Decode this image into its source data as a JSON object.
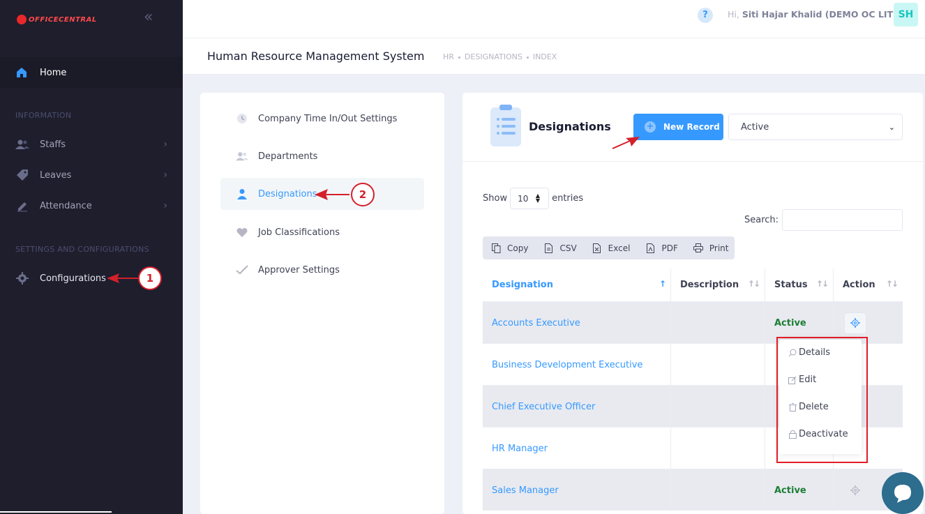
{
  "brand": {
    "logo_text": "OFFICECENTRAL"
  },
  "sidebar": {
    "home": "Home",
    "section_information": "INFORMATION",
    "items": [
      {
        "label": "Staffs"
      },
      {
        "label": "Leaves"
      },
      {
        "label": "Attendance"
      }
    ],
    "section_settings": "SETTINGS AND CONFIGURATIONS",
    "configurations": "Configurations"
  },
  "topbar": {
    "help": "?",
    "greeting_prefix": "Hi,",
    "user_name": "Siti Hajar Khalid (DEMO OC LITE)",
    "avatar_initials": "SH"
  },
  "subheader": {
    "title": "Human Resource Management System",
    "breadcrumbs": [
      "HR",
      "DESIGNATIONS",
      "INDEX"
    ]
  },
  "settings_menu": [
    {
      "label": "Company Time In/Out Settings",
      "icon": "clock-icon"
    },
    {
      "label": "Departments",
      "icon": "users-icon"
    },
    {
      "label": "Designations",
      "icon": "user-icon",
      "active": true
    },
    {
      "label": "Job Classifications",
      "icon": "heart-icon"
    },
    {
      "label": "Approver Settings",
      "icon": "check-icon"
    }
  ],
  "panel": {
    "title": "Designations",
    "new_record": "New Record",
    "status_filter": "Active",
    "show_label": "Show",
    "entries_value": "10",
    "entries_label": "entries",
    "search_label": "Search:",
    "export_buttons": [
      "Copy",
      "CSV",
      "Excel",
      "PDF",
      "Print"
    ]
  },
  "table": {
    "columns": [
      "Designation",
      "Description",
      "Status",
      "Action"
    ],
    "rows": [
      {
        "designation": "Accounts Executive",
        "description": "",
        "status": "Active"
      },
      {
        "designation": "Business Development Executive",
        "description": "",
        "status": ""
      },
      {
        "designation": "Chief Executive Officer",
        "description": "",
        "status": ""
      },
      {
        "designation": "HR Manager",
        "description": "",
        "status": ""
      },
      {
        "designation": "Sales Manager",
        "description": "",
        "status": "Active"
      }
    ]
  },
  "action_menu": [
    "Details",
    "Edit",
    "Delete",
    "Deactivate"
  ],
  "annotations": {
    "marker_1": "1",
    "marker_2": "2"
  },
  "colors": {
    "primary": "#3699ff",
    "sidebar": "#1e1e2d",
    "annotation_red": "#e11c25",
    "active_green": "#1e7e34"
  }
}
